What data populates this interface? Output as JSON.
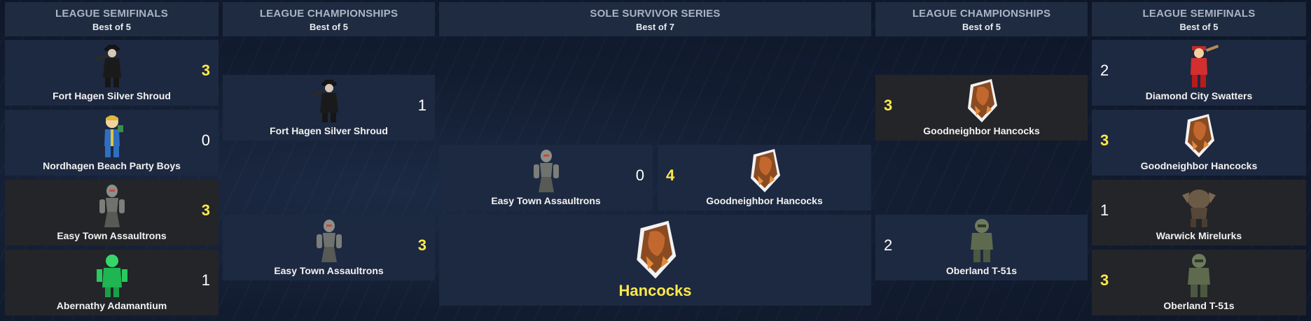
{
  "headers": {
    "left_semis": {
      "title": "LEAGUE SEMIFINALS",
      "sub": "Best of 5"
    },
    "left_champ": {
      "title": "LEAGUE CHAMPIONSHIPS",
      "sub": "Best of 5"
    },
    "finals": {
      "title": "SOLE SURVIVOR SERIES",
      "sub": "Best of 7"
    },
    "right_champ": {
      "title": "LEAGUE CHAMPIONSHIPS",
      "sub": "Best of 5"
    },
    "right_semis": {
      "title": "LEAGUE SEMIFINALS",
      "sub": "Best of 5"
    }
  },
  "left_semis": [
    {
      "team": "Fort Hagen Silver Shroud",
      "score": "3",
      "winner": true,
      "icon": "silver-shroud-icon"
    },
    {
      "team": "Nordhagen Beach Party Boys",
      "score": "0",
      "winner": false,
      "icon": "vault-boy-icon"
    },
    {
      "team": "Easy Town Assaultrons",
      "score": "3",
      "winner": true,
      "icon": "assaultron-icon"
    },
    {
      "team": "Abernathy Adamantium",
      "score": "1",
      "winner": false,
      "icon": "adamantium-icon"
    }
  ],
  "left_champ": [
    {
      "team": "Fort Hagen Silver Shroud",
      "score": "1",
      "winner": false,
      "icon": "silver-shroud-icon"
    },
    {
      "team": "Easy Town Assaultrons",
      "score": "3",
      "winner": true,
      "icon": "assaultron-icon"
    }
  ],
  "finals": [
    {
      "team": "Easy Town Assaultrons",
      "score": "0",
      "winner": false,
      "icon": "assaultron-icon"
    },
    {
      "team": "Goodneighbor Hancocks",
      "score": "4",
      "winner": true,
      "icon": "hancock-icon"
    }
  ],
  "champion": {
    "name": "Hancocks",
    "icon": "hancock-icon"
  },
  "right_champ": [
    {
      "team": "Goodneighbor Hancocks",
      "score": "3",
      "winner": true,
      "icon": "hancock-icon"
    },
    {
      "team": "Oberland T-51s",
      "score": "2",
      "winner": false,
      "icon": "power-armor-icon"
    }
  ],
  "right_semis": [
    {
      "team": "Diamond City Swatters",
      "score": "2",
      "winner": false,
      "icon": "swatter-icon"
    },
    {
      "team": "Goodneighbor Hancocks",
      "score": "3",
      "winner": true,
      "icon": "hancock-icon"
    },
    {
      "team": "Warwick Mirelurks",
      "score": "1",
      "winner": false,
      "icon": "mirelurk-icon"
    },
    {
      "team": "Oberland T-51s",
      "score": "3",
      "winner": true,
      "icon": "power-armor-icon"
    }
  ],
  "colors": {
    "winner_score": "#ffe94a",
    "card_blue": "#1d2940",
    "card_dark": "#232529"
  }
}
